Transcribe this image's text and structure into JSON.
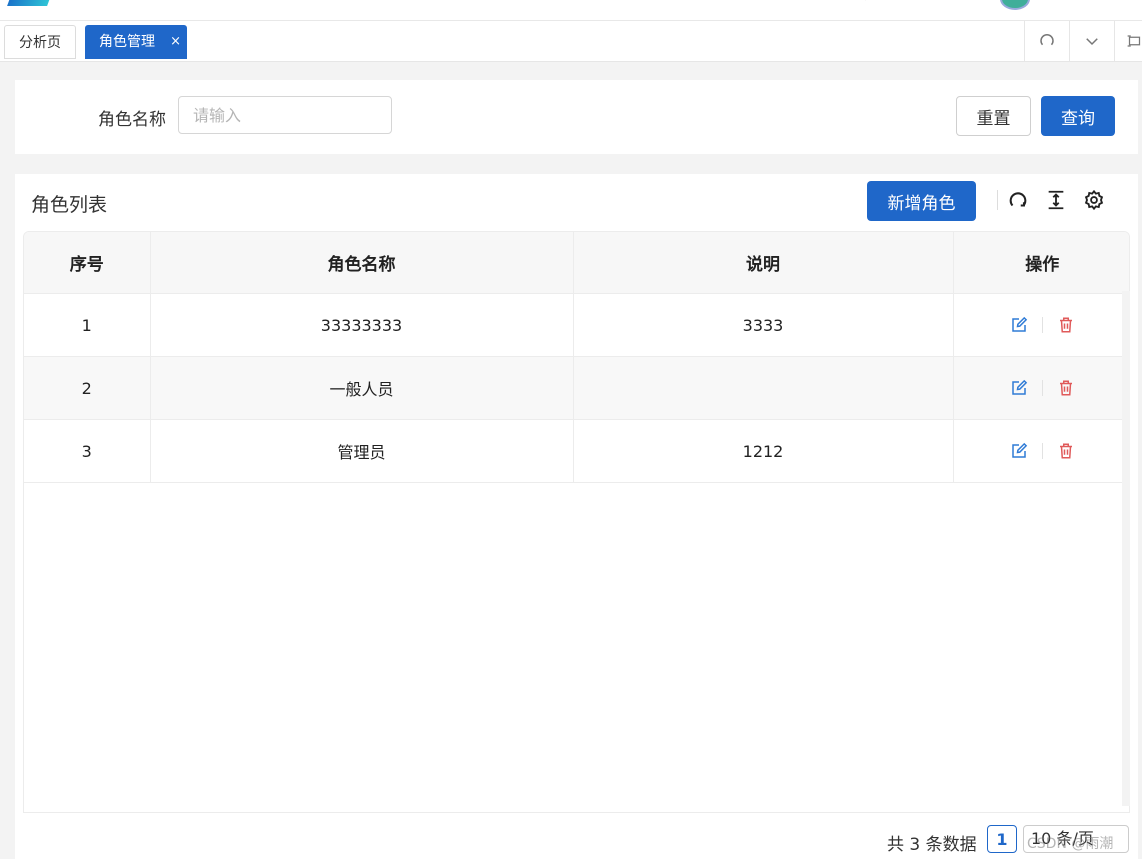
{
  "tabs": [
    {
      "label": "分析页"
    },
    {
      "label": "角色管理",
      "close": "×"
    }
  ],
  "search": {
    "label": "角色名称",
    "placeholder": "请输入",
    "value": "",
    "reset_label": "重置",
    "query_label": "查询"
  },
  "list": {
    "title": "角色列表",
    "add_label": "新增角色",
    "columns": [
      "序号",
      "角色名称",
      "说明",
      "操作"
    ],
    "rows": [
      {
        "index": "1",
        "name": "33333333",
        "desc": "3333"
      },
      {
        "index": "2",
        "name": "一般人员",
        "desc": ""
      },
      {
        "index": "3",
        "name": "管理员",
        "desc": "1212"
      }
    ]
  },
  "pagination": {
    "total_text": "共 3 条数据",
    "current_page": "1",
    "page_size_text": "10 条/页"
  },
  "watermark": "CSDN @雨潮",
  "colors": {
    "primary": "#1f67c9",
    "danger": "#e05a5a",
    "edit": "#2f7bd6"
  },
  "icons": [
    "refresh-icon",
    "chevron-down-icon",
    "fullscreen-icon",
    "column-height-icon",
    "settings-icon",
    "edit-icon",
    "delete-icon"
  ]
}
